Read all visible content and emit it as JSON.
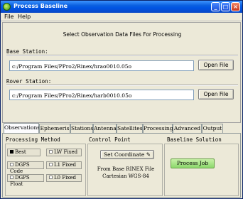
{
  "window": {
    "title": "Process Baseline",
    "min_icon": "minimize-icon",
    "max_icon": "maximize-icon",
    "close_icon": "close-icon"
  },
  "menu": {
    "file": "File",
    "help": "Help"
  },
  "main": {
    "instruction": "Select Observation Data Files For Processing",
    "base": {
      "label": "Base Station:",
      "path": "c:/Program Files/PPro2/Rinex/hrao0010.05o",
      "button": "Open File"
    },
    "rover": {
      "label": "Rover Station:",
      "path": "c:/Program Files/PPro2/Rinex/harb0010.05o",
      "button": "Open File"
    }
  },
  "tabs": [
    {
      "label": "Observations",
      "active": true
    },
    {
      "label": "Ephemeris",
      "active": false
    },
    {
      "label": "Stations",
      "active": false
    },
    {
      "label": "Antenna",
      "active": false
    },
    {
      "label": "Satellites",
      "active": false
    },
    {
      "label": "Processing",
      "active": false
    },
    {
      "label": "Advanced",
      "active": false
    },
    {
      "label": "Output",
      "active": false
    }
  ],
  "processing_method": {
    "title": "Processing Method",
    "options": [
      {
        "label": "Best",
        "selected": true
      },
      {
        "label": "LW Fixed",
        "selected": false
      },
      {
        "label": "DGPS Code",
        "selected": false
      },
      {
        "label": "L1 Fixed",
        "selected": false
      },
      {
        "label": "DGPS Float",
        "selected": false
      },
      {
        "label": "L0 Fixed",
        "selected": false
      }
    ]
  },
  "control_point": {
    "title": "Control Point",
    "button": "Set Coordinate",
    "button_icon": "edit-icon",
    "note_line1": "From Base RINEX File",
    "note_line2": "Cartesian WGS-84"
  },
  "baseline_solution": {
    "title": "Baseline Solution",
    "button": "Process Job"
  }
}
